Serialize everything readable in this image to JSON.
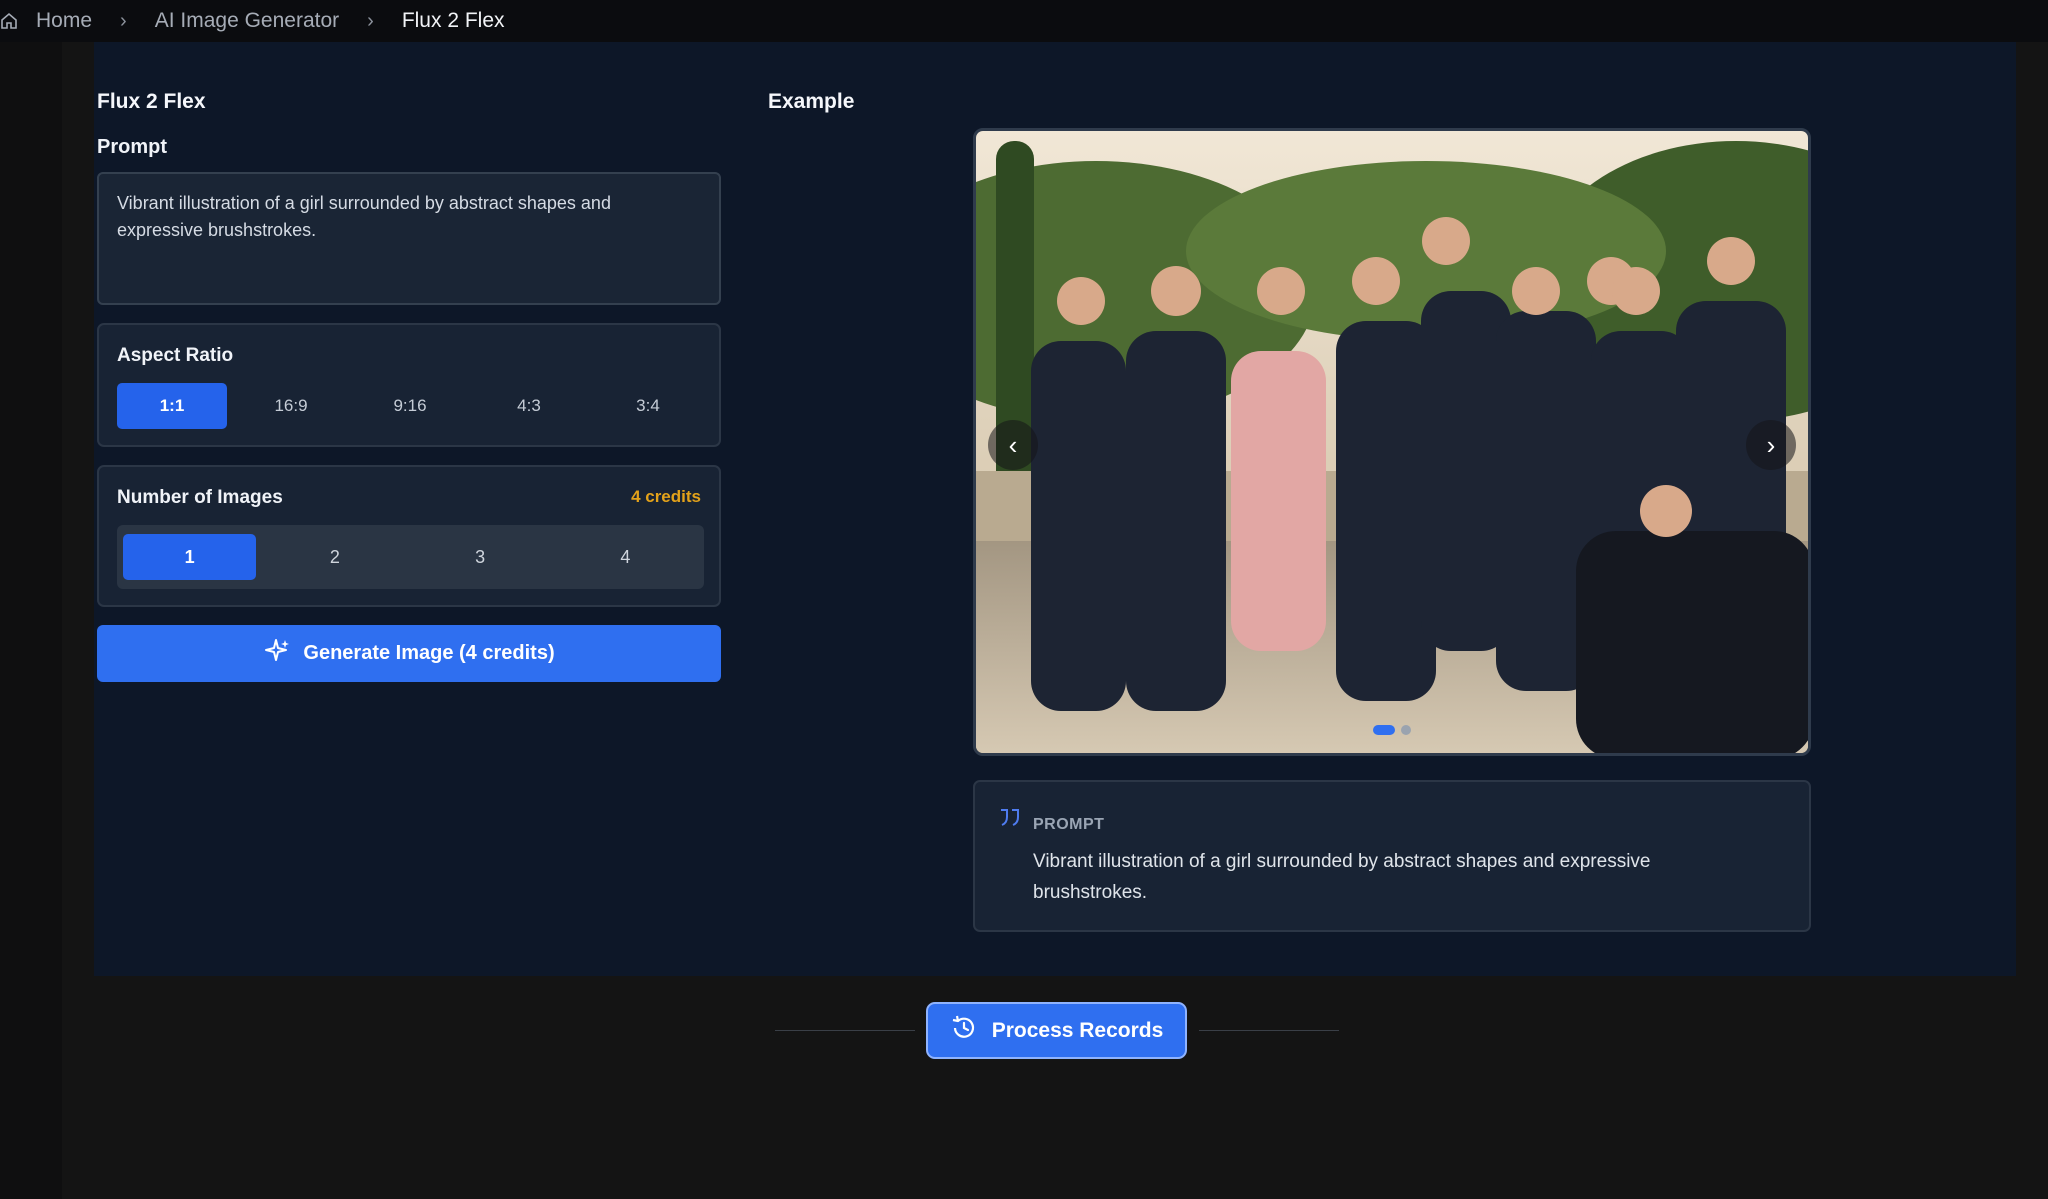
{
  "breadcrumb": {
    "home": "Home",
    "section": "AI Image Generator",
    "current": "Flux 2 Flex"
  },
  "form": {
    "title": "Flux 2 Flex",
    "prompt_label": "Prompt",
    "prompt_value": "Vibrant illustration of a girl surrounded by abstract shapes and expressive brushstrokes.",
    "aspect_ratio": {
      "label": "Aspect Ratio",
      "options": [
        "1:1",
        "16:9",
        "9:16",
        "4:3",
        "3:4"
      ],
      "selected": "1:1"
    },
    "num_images": {
      "label": "Number of Images",
      "credits": "4 credits",
      "options": [
        "1",
        "2",
        "3",
        "4"
      ],
      "selected": "1"
    },
    "generate_label": "Generate Image (4 credits)"
  },
  "example": {
    "title": "Example",
    "carousel": {
      "slides": 2,
      "active_index": 0
    },
    "prompt_heading": "PROMPT",
    "prompt_text": "Vibrant illustration of a girl surrounded by abstract shapes and expressive brushstrokes."
  },
  "records": {
    "label": "Process Records"
  },
  "colors": {
    "accent": "#2563eb",
    "credits": "#e3a21a",
    "panel": "#0d1728",
    "card": "#182334"
  }
}
